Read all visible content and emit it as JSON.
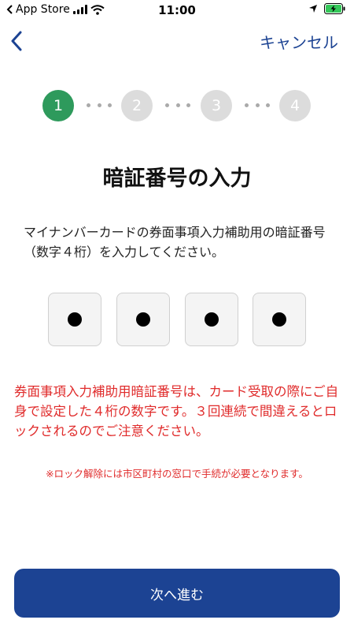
{
  "status_bar": {
    "carrier": "App Store",
    "time": "11:00"
  },
  "nav": {
    "cancel_label": "キャンセル"
  },
  "stepper": {
    "steps": [
      "1",
      "2",
      "3",
      "4"
    ],
    "current_step": 1
  },
  "title": "暗証番号の入力",
  "description": "マイナンバーカードの券面事項入力補助用の暗証番号（数字４桁）を入力してください。",
  "pin": {
    "length": 4,
    "filled": 4
  },
  "warning": "券面事項入力補助用暗証番号は、カード受取の際にご自身で設定した４桁の数字です。３回連続で間違えるとロックされるのでご注意ください。",
  "note": "※ロック解除には市区町村の窓口で手続が必要となります。",
  "next_button_label": "次へ進む",
  "colors": {
    "accent": "#1c4393",
    "active_step": "#2e9a5c",
    "warning": "#e02b2b",
    "battery": "#34c759"
  }
}
